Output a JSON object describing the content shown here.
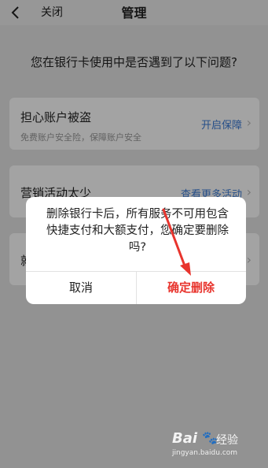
{
  "navbar": {
    "close_label": "关闭",
    "title": "管理"
  },
  "question": "您在银行卡使用中是否遇到了以下问题?",
  "cards": [
    {
      "title": "担心账户被盗",
      "subtitle": "免费账户安全险，保障账户安全",
      "action": "开启保障"
    },
    {
      "title": "营销活动太少",
      "action": "查看更多活动"
    },
    {
      "title": "就"
    }
  ],
  "dialog": {
    "message": "删除银行卡后，所有服务不可用包含快捷支付和大额支付，您确定要删除吗?",
    "cancel_label": "取消",
    "confirm_label": "确定删除"
  },
  "watermark": {
    "logo": "Bai",
    "paw": "🐾",
    "brand": "经验",
    "url": "jingyan.baidu.com"
  },
  "colors": {
    "accent": "#3a7bd5",
    "danger": "#e8342d"
  }
}
